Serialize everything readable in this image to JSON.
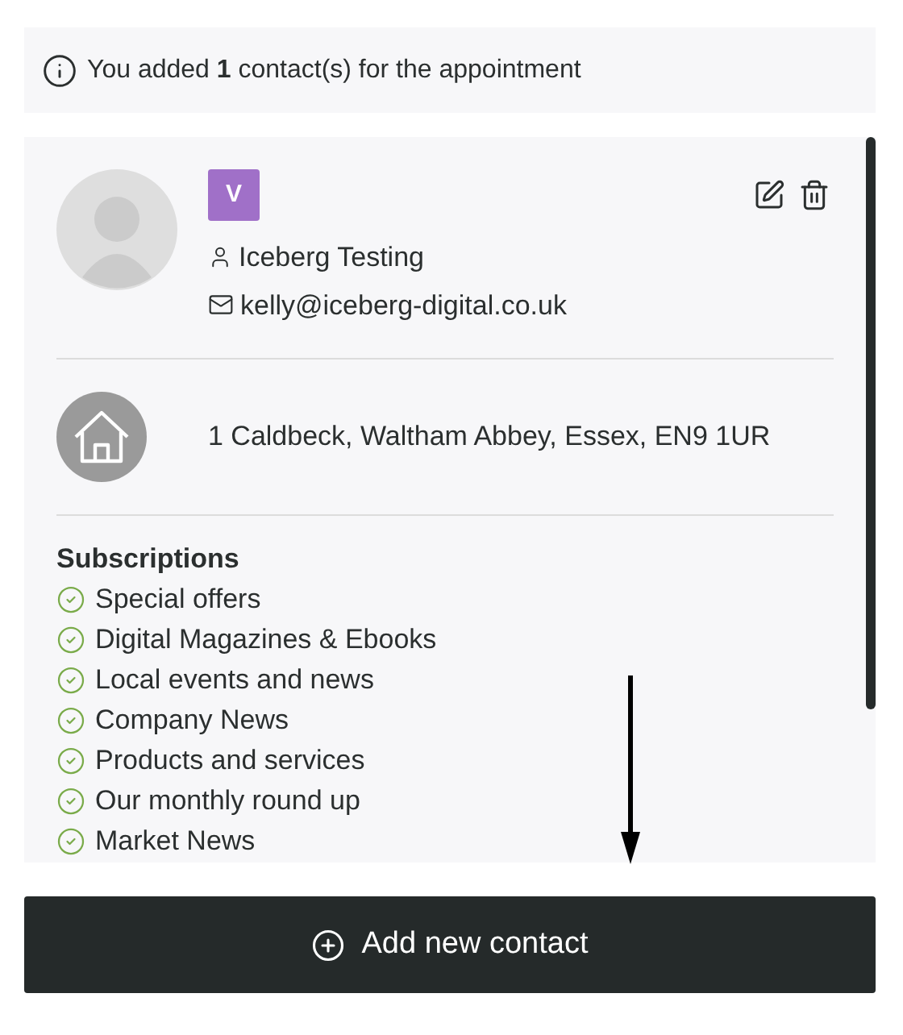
{
  "notice": {
    "text": "You added **1** contact(s) for the appointment"
  },
  "contact": {
    "badge": "V",
    "name": "Iceberg Testing",
    "email": "kelly@iceberg-digital.co.uk",
    "address": "1 Caldbeck, Waltham Abbey, Essex, EN9 1UR"
  },
  "subscriptions": {
    "title": "Subscriptions",
    "items": [
      {
        "label": "Special offers",
        "checked": true
      },
      {
        "label": "Digital Magazines & Ebooks",
        "checked": true
      },
      {
        "label": "Local events and news",
        "checked": true
      },
      {
        "label": "Company News",
        "checked": true
      },
      {
        "label": "Products and services",
        "checked": true
      },
      {
        "label": "Our monthly round up",
        "checked": true
      },
      {
        "label": "Market News",
        "checked": true
      }
    ]
  },
  "add_button": {
    "label": "Add new contact"
  }
}
